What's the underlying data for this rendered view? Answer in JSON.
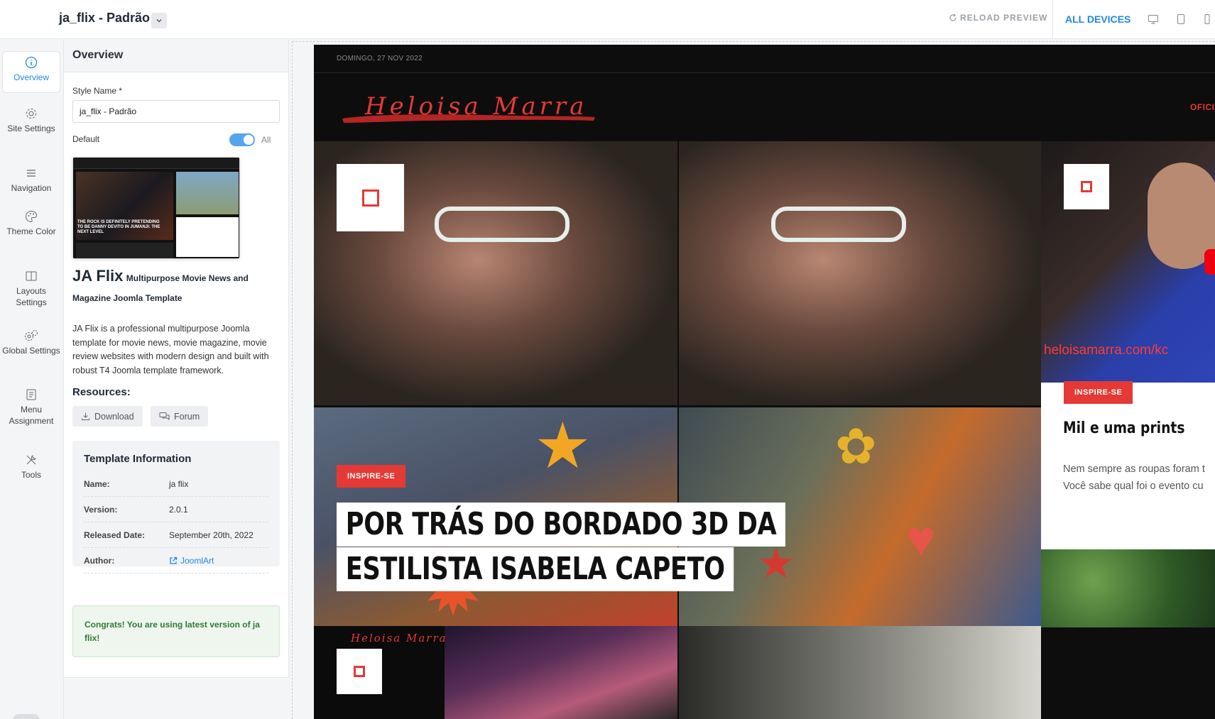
{
  "header": {
    "style_title": "ja_flix - Padrão",
    "reload_label": "RELOAD PREVIEW",
    "all_devices_label": "ALL DEVICES",
    "device_icons": [
      "desktop-icon",
      "tablet-icon",
      "mobile-icon"
    ]
  },
  "sidebar": {
    "items": [
      {
        "label": "Overview",
        "icon": "info-icon",
        "active": true
      },
      {
        "label": "Site Settings",
        "icon": "gear-icon"
      },
      {
        "label": "Navigation",
        "icon": "menu-icon"
      },
      {
        "label": "Theme Color",
        "icon": "palette-icon"
      },
      {
        "label": "Layouts Settings",
        "icon": "layout-icon"
      },
      {
        "label": "Global Settings",
        "icon": "gears-icon"
      },
      {
        "label": "Menu Assignment",
        "icon": "list-icon"
      },
      {
        "label": "Tools",
        "icon": "tools-icon"
      }
    ]
  },
  "panel": {
    "title": "Overview",
    "style_name_label": "Style Name *",
    "style_name_value": "ja_flix - Padrão",
    "default_label": "Default",
    "default_toggle_label": "All",
    "default_enabled": true,
    "thumbnail_caption": "THE ROCK IS DEFINITELY PRETENDING TO BE DANNY DEVITO IN JUMANJI: THE NEXT LEVEL",
    "template_name": "JA Flix",
    "template_subtitle": "Multipurpose Movie News and Magazine Joomla Template",
    "template_description": "JA Flix is a professional multipurpose Joomla template for movie news, movie magazine, movie review websites with modern design and built with robust T4 Joomla template framework.",
    "resources_title": "Resources:",
    "download_label": "Download",
    "forum_label": "Forum",
    "info": {
      "title": "Template Information",
      "rows": [
        {
          "key": "Name:",
          "value": "ja flix"
        },
        {
          "key": "Version:",
          "value": "2.0.1"
        },
        {
          "key": "Released Date:",
          "value": "September 20th, 2022"
        },
        {
          "key": "Author:",
          "value": "JoomlArt"
        }
      ]
    },
    "congrats": "Congrats! You are using latest version of ja flix!"
  },
  "preview": {
    "date": "DOMINGO, 27 NOV 2022",
    "logo_text": "Heloisa Marra",
    "nav_partial": "OFICI",
    "hero": {
      "tag": "INSPIRE-SE",
      "headline_line1": "POR TRÁS DO BORDADO 3D DA",
      "headline_line2": "ESTILISTA ISABELA CAPETO"
    },
    "side_card": {
      "url_overlay": "heloisamarra.com/kc",
      "tag": "INSPIRE-SE",
      "title": "Mil e uma prints",
      "text_line1": "Nem sempre as roupas foram t",
      "text_line2": "Você sabe qual foi o evento cu"
    },
    "bottom_logo": "Heloisa Marra"
  },
  "colors": {
    "accent": "#1e88e5",
    "brand_red": "#e53935",
    "success_text": "#2e7d32"
  }
}
